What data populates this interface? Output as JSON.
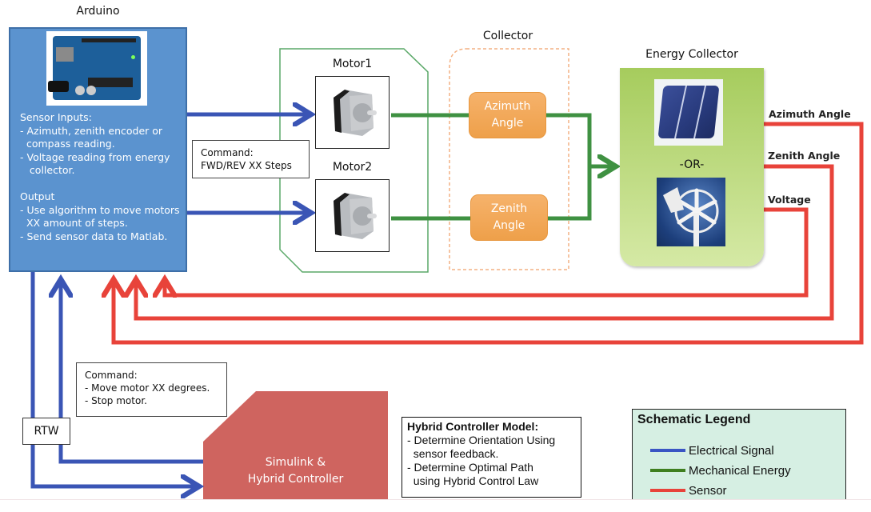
{
  "diagram": {
    "arduino": {
      "title": "Arduino",
      "image": "arduino-board",
      "description": "Sensor Inputs:\n- Azimuth, zenith encoder or\n  compass reading.\n- Voltage reading from energy\n   collector.\n\nOutput\n- Use algorithm to move motors\n  XX amount of steps.\n- Send sensor data to Matlab."
    },
    "motors": [
      {
        "label": "Motor1",
        "image": "stepper-motor"
      },
      {
        "label": "Motor2",
        "image": "stepper-motor"
      }
    ],
    "motor_command": "Command:\nFWD/REV XX Steps",
    "collector": {
      "title": "Collector",
      "angles": [
        {
          "label": "Azimuth\nAngle"
        },
        {
          "label": "Zenith\nAngle"
        }
      ]
    },
    "energy_collector": {
      "title": "Energy Collector",
      "separator": "-OR-",
      "options": [
        "solar-cell",
        "wind-turbine"
      ]
    },
    "sensor_outputs": [
      {
        "label": "Azimuth Angle"
      },
      {
        "label": "Zenith Angle"
      },
      {
        "label": "Voltage"
      }
    ],
    "rtw_label": "RTW",
    "simulink_command": "Command:\n- Move motor XX degrees.\n- Stop motor.",
    "controller": {
      "label": "Simulink &\nHybrid Controller"
    },
    "hybrid_model": {
      "heading": "Hybrid Controller Model:",
      "lines": [
        "- Determine Orientation Using",
        "  sensor feedback.",
        "- Determine Optimal Path",
        "  using Hybrid Control Law"
      ]
    },
    "legend": {
      "title": "Schematic Legend",
      "items": [
        {
          "label": "Electrical Signal",
          "color": "#3a55c4"
        },
        {
          "label": "Mechanical Energy",
          "color": "#3f7f1f"
        },
        {
          "label": "Sensor",
          "color": "#e8433a"
        }
      ]
    },
    "colors": {
      "electrical": "#3a55b5",
      "mechanical": "#3f9142",
      "sensor": "#e8433a",
      "arduino_fill": "#5b93cf",
      "controller_fill": "#cf645f",
      "collector_dash": "#f4b183",
      "enclosure": "#5aa868"
    }
  }
}
